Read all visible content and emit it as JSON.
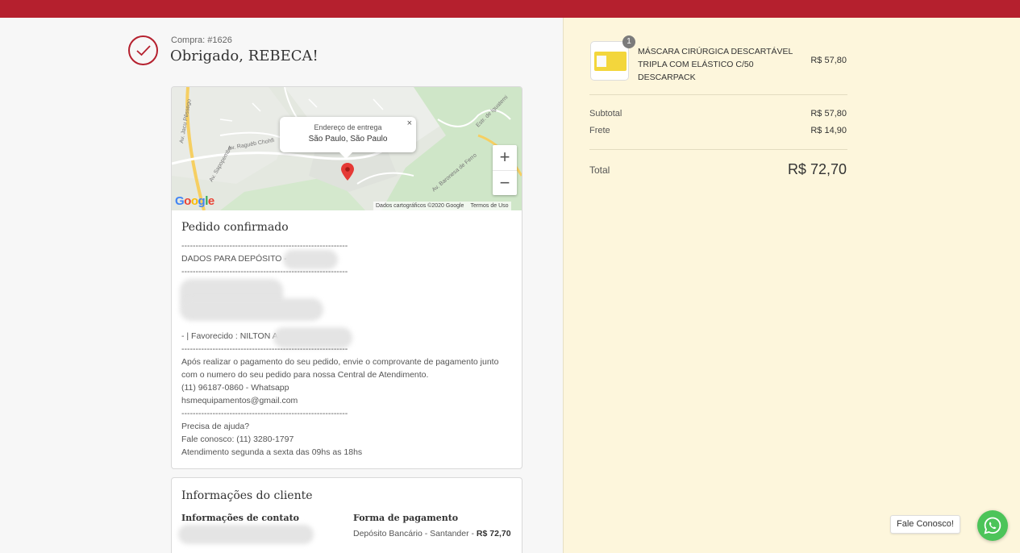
{
  "order": {
    "number": "Compra: #1626",
    "thanks": "Obrigado, REBECA!"
  },
  "map": {
    "popup_title": "Endereço de entrega",
    "popup_city": "São Paulo, São Paulo",
    "close": "×",
    "zoom_in": "+",
    "zoom_out": "−",
    "google": "Google",
    "attribution": "Dados cartográficos ©2020 Google",
    "terms": "Termos de Uso",
    "streets": [
      "Av. Jacu Pêssego",
      "Av. Raguêb Chohfi",
      "Av. Sapopemba",
      "Estr. de Iguatemi",
      "Av. Baronesa de Ferro"
    ]
  },
  "confirmation": {
    "title": "Pedido confirmado",
    "divider": "-----------------------------------------------------------",
    "deposit_heading": "DADOS PARA DEPÓSITO -",
    "favored": "- | Favorecido : NILTON A",
    "instructions_1": "Após realizar o pagamento do seu pedido, envie o comprovante de pagamento junto",
    "instructions_2": "com o numero do seu pedido para nossa Central de Atendimento.",
    "whatsapp": "(11) 96187-0860 - Whatsapp",
    "email": "hsmequipamentos@gmail.com",
    "help": "Precisa de ajuda?",
    "contact": "Fale conosco: (11) 3280-1797",
    "hours": "Atendimento segunda a sexta das 09hs as 18hs"
  },
  "customer": {
    "title": "Informações do cliente",
    "contact_head": "Informações de contato",
    "payment_head": "Forma de pagamento",
    "payment_method": "Depósito Bancário - Santander -",
    "payment_amount": "R$ 72,70"
  },
  "summary": {
    "qty": "1",
    "product_name": "MÁSCARA CIRÚRGICA DESCARTÁVEL TRIPLA COM ELÁSTICO C/50 DESCARPACK",
    "product_price": "R$ 57,80",
    "subtotal_label": "Subtotal",
    "subtotal_value": "R$ 57,80",
    "shipping_label": "Frete",
    "shipping_value": "R$ 14,90",
    "total_label": "Total",
    "total_value": "R$ 72,70"
  },
  "chat": {
    "label": "Fale Conosco!"
  },
  "colors": {
    "brand": "#b5202e",
    "sidebar": "#fdf6dc",
    "whatsapp": "#4cc459"
  }
}
